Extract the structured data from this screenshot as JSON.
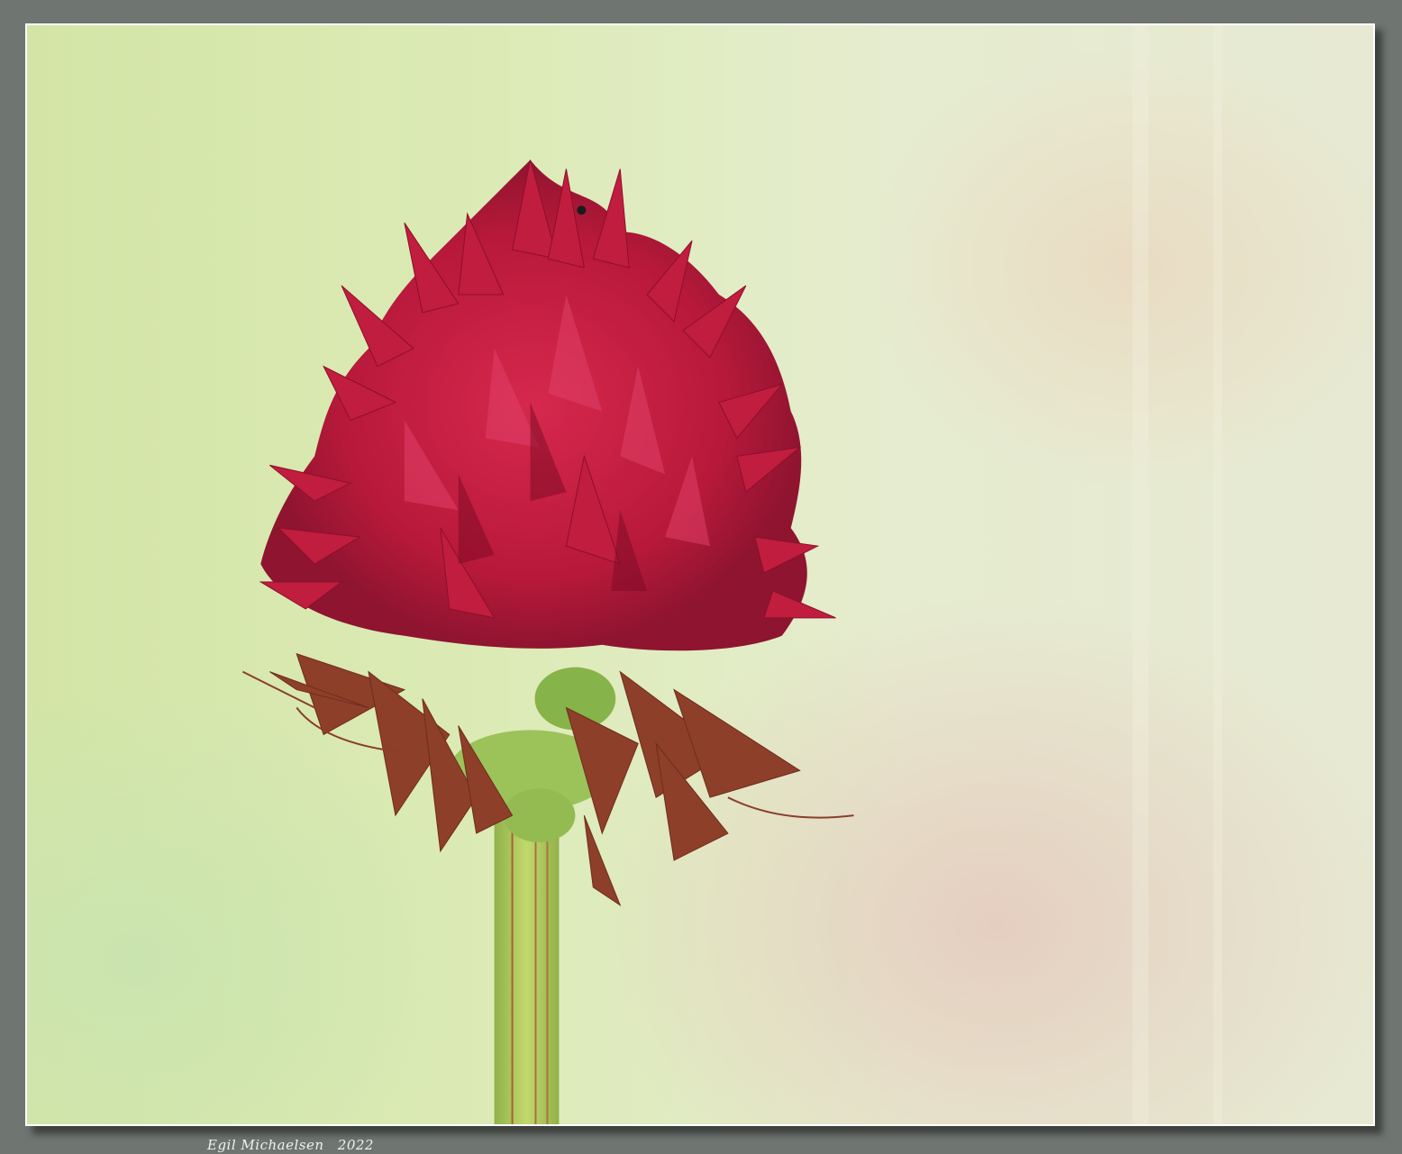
{
  "photo": {
    "subject": "red-flower-head",
    "background_colors": [
      "#d8e7b4",
      "#eaeecf",
      "#e6d8cb"
    ],
    "flower_color": "#c0203f",
    "wilted_color": "#8a3a28",
    "stem_color": "#a9c656",
    "border_color": "#ffffff",
    "mat_color": "#6f7570"
  },
  "signature": {
    "name": "Egil Michaelsen",
    "year": "2022"
  }
}
